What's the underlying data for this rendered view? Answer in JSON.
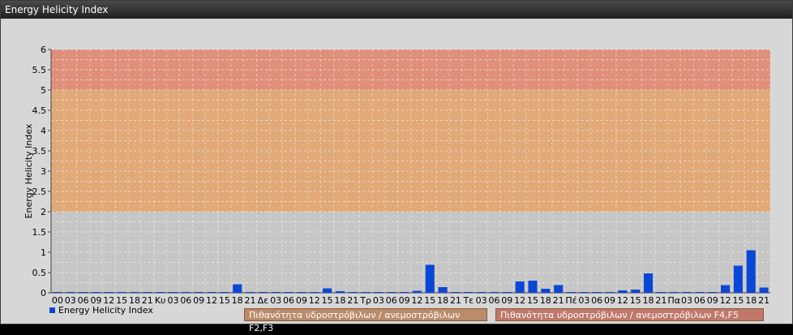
{
  "window": {
    "title": "Energy Helicity Index"
  },
  "legend": {
    "label": "Energy Helicity Index",
    "color": "#0b47d6"
  },
  "band_notes": [
    "Πιθανότητα υδροστρόβιλων / ανεμοστρόβιλων F2,F3",
    "Πιθανότητα υδροστρόβιλων / ανεμοστρόβιλων F4,F5"
  ],
  "chart_data": {
    "type": "bar",
    "ylabel": "Energy Helicity Index",
    "ylim": [
      0,
      6
    ],
    "yticks": [
      "0",
      "0.5",
      "1",
      "1.5",
      "2",
      "2.5",
      "3",
      "3.5",
      "4",
      "4.5",
      "5",
      "5.5",
      "6"
    ],
    "bands": [
      {
        "from": 2,
        "to": 5,
        "color": "#e1a878"
      },
      {
        "from": 5,
        "to": 6,
        "color": "#df8f7a"
      }
    ],
    "categories": [
      "00",
      "03",
      "06",
      "09",
      "12",
      "15",
      "18",
      "21",
      "Κυ",
      "03",
      "06",
      "09",
      "12",
      "15",
      "18",
      "21",
      "Δε",
      "03",
      "06",
      "09",
      "12",
      "15",
      "18",
      "21",
      "Τρ",
      "03",
      "06",
      "09",
      "12",
      "15",
      "18",
      "21",
      "Τε",
      "03",
      "06",
      "09",
      "12",
      "15",
      "18",
      "21",
      "Πέ",
      "03",
      "06",
      "09",
      "12",
      "15",
      "18",
      "21",
      "Πα",
      "03",
      "06",
      "09",
      "12",
      "15",
      "18",
      "21"
    ],
    "values": [
      0.02,
      0.02,
      0.02,
      0.02,
      0.02,
      0.02,
      0.02,
      0.02,
      0.02,
      0.02,
      0.02,
      0.02,
      0.02,
      0.02,
      0.21,
      0.02,
      0.02,
      0.02,
      0.02,
      0.02,
      0.02,
      0.11,
      0.04,
      0.02,
      0.02,
      0.02,
      0.02,
      0.02,
      0.05,
      0.69,
      0.14,
      0.02,
      0.02,
      0.02,
      0.02,
      0.02,
      0.28,
      0.3,
      0.1,
      0.19,
      0.02,
      0.02,
      0.02,
      0.02,
      0.06,
      0.08,
      0.48,
      0.02,
      0.02,
      0.02,
      0.02,
      0.02,
      0.19,
      0.67,
      1.05,
      0.13
    ]
  }
}
